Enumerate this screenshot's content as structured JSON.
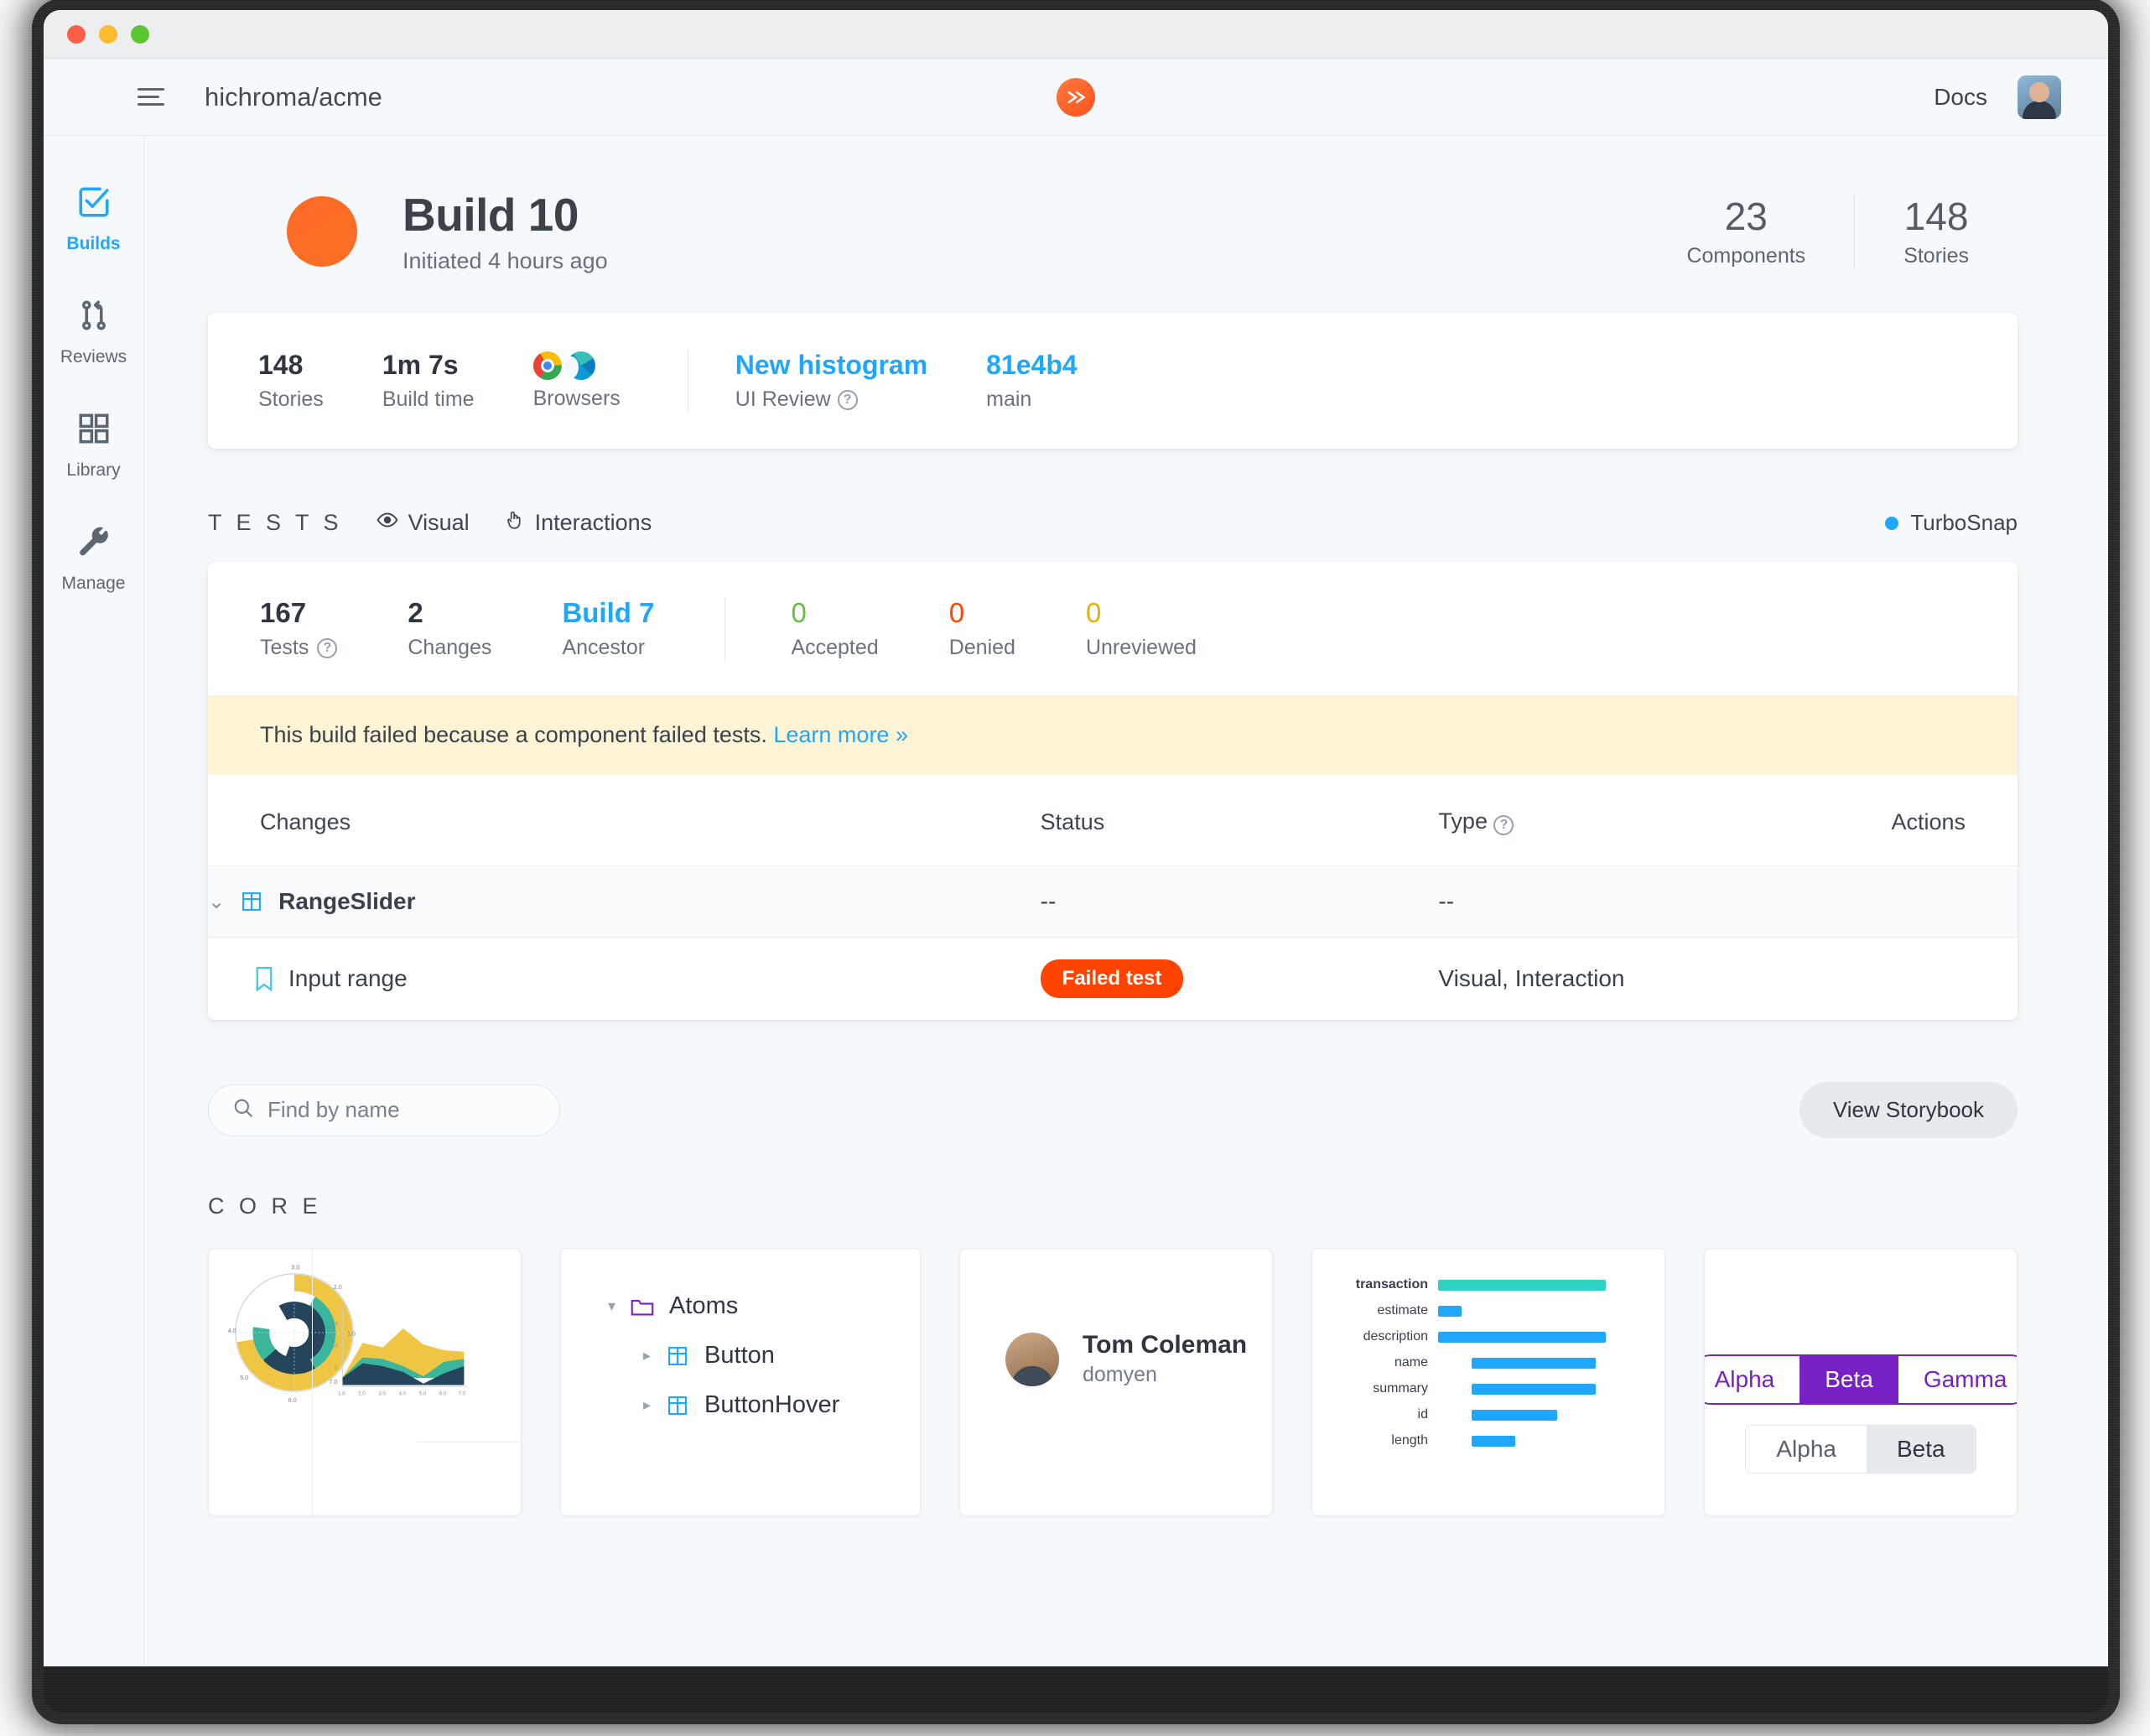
{
  "window": {
    "traffic_lights": [
      "close",
      "minimize",
      "maximize"
    ]
  },
  "topnav": {
    "repo": "hichroma/acme",
    "docs_label": "Docs",
    "logo_icon": "chromatic-logo-icon",
    "menu_icon": "hamburger-menu-icon",
    "avatar_icon": "user-avatar"
  },
  "sidebar": {
    "items": [
      {
        "label": "Builds",
        "icon": "checkbox-check-icon",
        "active": true
      },
      {
        "label": "Reviews",
        "icon": "git-pull-request-icon",
        "active": false
      },
      {
        "label": "Library",
        "icon": "grid-squares-icon",
        "active": false
      },
      {
        "label": "Manage",
        "icon": "wrench-icon",
        "active": false
      }
    ]
  },
  "build_header": {
    "status_color": "#fc5f20",
    "title": "Build 10",
    "subtitle": "Initiated 4 hours ago",
    "stats": [
      {
        "value": "23",
        "label": "Components"
      },
      {
        "value": "148",
        "label": "Stories"
      }
    ]
  },
  "info_card": {
    "left_stats": [
      {
        "value": "148",
        "label": "Stories"
      },
      {
        "value": "1m 7s",
        "label": "Build time"
      }
    ],
    "browsers": {
      "label": "Browsers",
      "items": [
        "chrome-icon",
        "edge-icon"
      ]
    },
    "right_stats": [
      {
        "value": "New histogram",
        "label": "UI Review",
        "link": true,
        "help": true
      },
      {
        "value": "81e4b4",
        "label": "main",
        "link": true,
        "help": false
      }
    ]
  },
  "tests_section": {
    "title": "T E S T S",
    "tabs": [
      {
        "label": "Visual",
        "icon": "eye-icon"
      },
      {
        "label": "Interactions",
        "icon": "pointer-hand-icon"
      }
    ],
    "turbosnap": {
      "label": "TurboSnap",
      "dot_color": "#1ea7fd"
    },
    "stats_left": [
      {
        "value": "167",
        "label": "Tests",
        "help": true,
        "color": "dark"
      },
      {
        "value": "2",
        "label": "Changes",
        "help": false,
        "color": "dark"
      },
      {
        "value": "Build 7",
        "label": "Ancestor",
        "help": false,
        "color": "blue"
      }
    ],
    "stats_right": [
      {
        "value": "0",
        "label": "Accepted",
        "color": "green"
      },
      {
        "value": "0",
        "label": "Denied",
        "color": "red"
      },
      {
        "value": "0",
        "label": "Unreviewed",
        "color": "amber"
      }
    ],
    "banner": {
      "text": "This build failed because a component failed tests. ",
      "link": "Learn more »",
      "bg_color": "#fdf4d5"
    },
    "table": {
      "columns": [
        "Changes",
        "Status",
        "Type",
        "Actions"
      ],
      "type_has_help": true,
      "rows": [
        {
          "kind": "group",
          "name": "RangeSlider",
          "icon": "component-grid-icon",
          "chevron": "chevron-down-icon",
          "status": "--",
          "type": "--",
          "actions": ""
        },
        {
          "kind": "story",
          "name": "Input range",
          "icon": "bookmark-story-icon",
          "status_badge": "Failed test",
          "status_badge_color": "#ff4400",
          "type": "Visual, Interaction",
          "actions": ""
        }
      ]
    }
  },
  "search": {
    "placeholder": "Find by name",
    "value": "",
    "icon": "search-icon"
  },
  "storybook_button": {
    "label": "View Storybook"
  },
  "core_section": {
    "title": "C O R E",
    "cards": [
      {
        "name": "charts-card",
        "chart_left": "radial-donut-chart",
        "chart_right": "stacked-area-chart"
      },
      {
        "name": "tree-card",
        "tree": [
          {
            "label": "Atoms",
            "icon": "folder-icon",
            "chevron": "chevron-down-icon",
            "depth": 0
          },
          {
            "label": "Button",
            "icon": "component-grid-icon",
            "chevron": "chevron-right-icon",
            "depth": 1
          },
          {
            "label": "ButtonHover",
            "icon": "component-grid-icon",
            "chevron": "chevron-right-icon",
            "depth": 1
          }
        ]
      },
      {
        "name": "person-card",
        "person_name": "Tom Coleman",
        "person_handle": "domyen"
      },
      {
        "name": "bar-chart-card",
        "bars": [
          {
            "label": "transaction",
            "value": 100,
            "bold": true,
            "color": "teal"
          },
          {
            "label": "estimate",
            "value": 14,
            "bold": false,
            "color": "blue"
          },
          {
            "label": "description",
            "value": 100,
            "bold": false,
            "color": "blue"
          },
          {
            "label": "name",
            "value": 66,
            "bold": false,
            "color": "blue"
          },
          {
            "label": "summary",
            "value": 66,
            "bold": false,
            "color": "blue"
          },
          {
            "label": "id",
            "value": 47,
            "bold": false,
            "color": "blue"
          },
          {
            "label": "length",
            "value": 24,
            "bold": false,
            "color": "blue"
          }
        ]
      },
      {
        "name": "tabs-card",
        "segmented_primary": [
          {
            "label": "Alpha",
            "selected": false
          },
          {
            "label": "Beta",
            "selected": true
          },
          {
            "label": "Gamma",
            "selected": false
          }
        ],
        "segmented_secondary": [
          {
            "label": "Alpha",
            "selected": false
          },
          {
            "label": "Beta",
            "selected": true
          }
        ]
      }
    ]
  },
  "chart_data": [
    {
      "type": "area",
      "title": "",
      "x": [
        1.0,
        2.0,
        3.0,
        4.0,
        5.0,
        6.0,
        7.0
      ],
      "xlabel": "",
      "ylabel": "",
      "ylim": [
        0,
        17
      ],
      "yticks": [
        5,
        10,
        15
      ],
      "xticks": [
        "1.0",
        "2.0",
        "3.0",
        "4.0",
        "5.0",
        "6.0",
        "7.0"
      ],
      "series": [
        {
          "name": "dark",
          "values": [
            10,
            9,
            8,
            5,
            2,
            5,
            7
          ],
          "color": "#24455c"
        },
        {
          "name": "teal",
          "values": [
            2,
            2,
            3,
            1,
            4,
            2,
            2
          ],
          "color": "#3bb59c"
        },
        {
          "name": "gold",
          "values": [
            4,
            3,
            4,
            5,
            5,
            3,
            2
          ],
          "color": "#eec643"
        }
      ]
    },
    {
      "type": "bar",
      "title": "",
      "categories": [
        "transaction",
        "estimate",
        "description",
        "name",
        "summary",
        "id",
        "length"
      ],
      "values": [
        100,
        14,
        100,
        66,
        66,
        47,
        24
      ],
      "xlabel": "",
      "ylabel": "",
      "colors": [
        "#2ed3c6",
        "#1ea7fd",
        "#1ea7fd",
        "#1ea7fd",
        "#1ea7fd",
        "#1ea7fd",
        "#1ea7fd"
      ]
    }
  ]
}
